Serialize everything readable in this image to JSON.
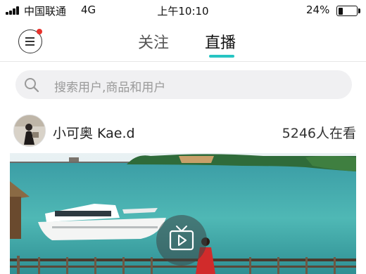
{
  "status_bar": {
    "carrier": "中国联通",
    "network": "4G",
    "time": "上午10:10",
    "battery_percent": "24%",
    "battery_level": 0.24
  },
  "header": {
    "tabs": [
      {
        "label": "关注",
        "active": false
      },
      {
        "label": "直播",
        "active": true
      }
    ],
    "accent_color": "#27c5c3",
    "notification_dot_color": "#e8322c"
  },
  "search": {
    "placeholder": "搜索用户,商品和用户"
  },
  "live_card": {
    "streamer_name": "小可奥 Kae.d",
    "viewer_count": "5246人在看"
  },
  "icons": [
    "menu-icon",
    "search-icon",
    "tv-play-icon"
  ]
}
